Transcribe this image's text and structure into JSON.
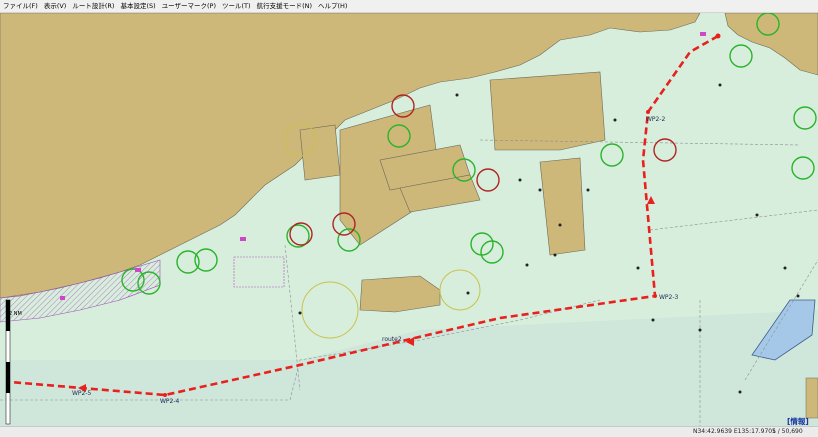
{
  "menu": {
    "items": [
      "ファイル(F)",
      "表示(V)",
      "ルート設計(R)",
      "基本設定(S)",
      "ユーザーマーク(P)",
      "ツール(T)",
      "航行支援モード(N)",
      "ヘルプ(H)"
    ]
  },
  "route": {
    "name": "route2",
    "waypoints": [
      "WP2-2",
      "WP2-3",
      "WP2-4",
      "WP2-5"
    ],
    "color": "#e8201e"
  },
  "scalebar": {
    "label": "2 NM"
  },
  "info_label": "[情報]",
  "status": {
    "coords": "N34:42.9639 E135:17.9705",
    "scale": "1 / 50,690"
  },
  "colors": {
    "land": "#cdb779",
    "sea": "#d7eedc",
    "deep_sea": "#c6e2d6",
    "ok_circle": "#2bb32b",
    "alert_circle": "#b02424"
  }
}
